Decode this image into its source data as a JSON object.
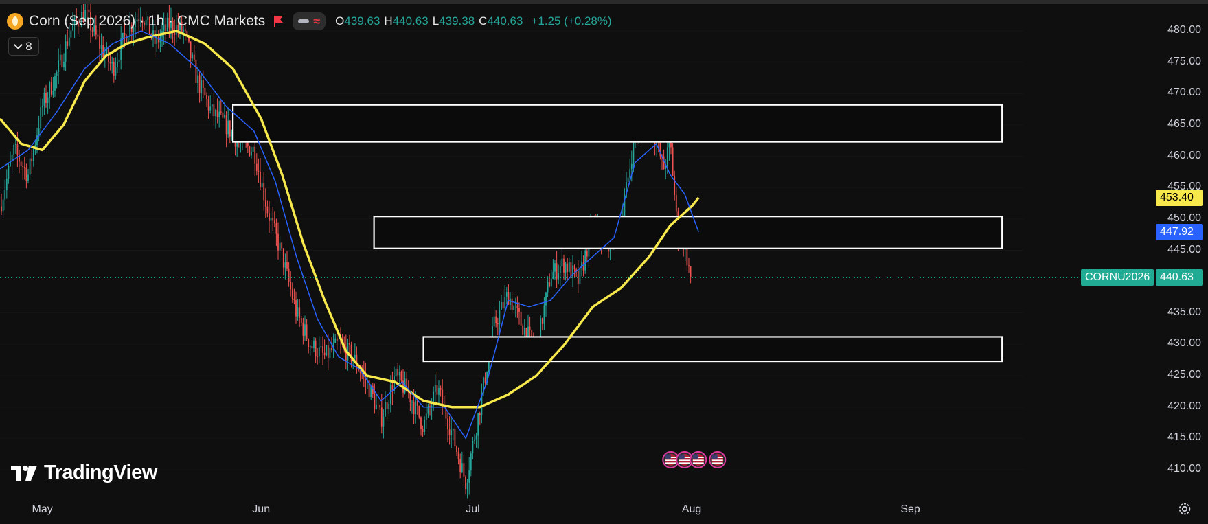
{
  "header": {
    "symbol_title": "Corn (Sep 2026) · 1h · CMC Markets",
    "ohlc": {
      "o_label": "O",
      "o": "439.63",
      "h_label": "H",
      "h": "440.63",
      "l_label": "L",
      "l": "439.38",
      "c_label": "C",
      "c": "440.63",
      "change": "+1.25 (+0.28%)"
    },
    "indicator_count": "8"
  },
  "colors": {
    "background": "#0f0f0f",
    "up": "#26a69a",
    "down": "#ef5350",
    "ma_slow": "#f7e84b",
    "ma_fast": "#2962ff",
    "zone_stroke": "#ffffff"
  },
  "chart_data": {
    "type": "candlestick",
    "symbol": "CORNU2026",
    "interval": "1h",
    "y_axis": {
      "ticks": [
        "480.00",
        "475.00",
        "470.00",
        "465.00",
        "460.00",
        "455.00",
        "450.00",
        "445.00",
        "435.00",
        "430.00",
        "425.00",
        "420.00",
        "415.00",
        "410.00"
      ],
      "ylim": [
        406,
        482
      ]
    },
    "x_axis": {
      "ticks": [
        "May",
        "Jun",
        "Jul",
        "Aug",
        "Sep"
      ],
      "range": [
        "2026-04-25",
        "2026-09-17"
      ]
    },
    "price_path": [
      [
        "2026-04-25",
        452
      ],
      [
        "2026-04-27",
        461
      ],
      [
        "2026-04-29",
        457
      ],
      [
        "2026-05-01",
        468
      ],
      [
        "2026-05-03",
        473
      ],
      [
        "2026-05-05",
        480
      ],
      [
        "2026-05-07",
        483
      ],
      [
        "2026-05-09",
        478
      ],
      [
        "2026-05-11",
        474
      ],
      [
        "2026-05-13",
        480
      ],
      [
        "2026-05-15",
        483
      ],
      [
        "2026-05-17",
        478
      ],
      [
        "2026-05-19",
        481
      ],
      [
        "2026-05-21",
        480
      ],
      [
        "2026-05-23",
        472
      ],
      [
        "2026-05-25",
        467
      ],
      [
        "2026-05-27",
        465
      ],
      [
        "2026-05-29",
        462
      ],
      [
        "2026-05-31",
        461
      ],
      [
        "2026-06-02",
        451
      ],
      [
        "2026-06-04",
        444
      ],
      [
        "2026-06-06",
        435
      ],
      [
        "2026-06-08",
        430
      ],
      [
        "2026-06-10",
        428
      ],
      [
        "2026-06-12",
        430
      ],
      [
        "2026-06-14",
        428
      ],
      [
        "2026-06-16",
        424
      ],
      [
        "2026-06-18",
        418
      ],
      [
        "2026-06-20",
        425
      ],
      [
        "2026-06-22",
        422
      ],
      [
        "2026-06-24",
        417
      ],
      [
        "2026-06-26",
        423
      ],
      [
        "2026-06-28",
        416
      ],
      [
        "2026-06-30",
        408
      ],
      [
        "2026-07-02",
        420
      ],
      [
        "2026-07-04",
        433
      ],
      [
        "2026-07-06",
        438
      ],
      [
        "2026-07-08",
        433
      ],
      [
        "2026-07-10",
        429
      ],
      [
        "2026-07-12",
        441
      ],
      [
        "2026-07-14",
        443
      ],
      [
        "2026-07-16",
        440
      ],
      [
        "2026-07-18",
        449
      ],
      [
        "2026-07-20",
        446
      ],
      [
        "2026-07-22",
        449
      ],
      [
        "2026-07-24",
        464
      ],
      [
        "2026-07-26",
        467
      ],
      [
        "2026-07-28",
        458
      ],
      [
        "2026-07-29",
        462
      ],
      [
        "2026-07-30",
        448
      ],
      [
        "2026-07-31",
        446
      ],
      [
        "2026-08-01",
        439.6
      ],
      [
        "2026-08-01",
        440.63
      ]
    ],
    "series": [
      {
        "name": "",
        "role": "slow moving average",
        "color": "#f7e84b",
        "points": [
          [
            "2026-04-25",
            466
          ],
          [
            "2026-04-28",
            462
          ],
          [
            "2026-05-01",
            461
          ],
          [
            "2026-05-04",
            465
          ],
          [
            "2026-05-07",
            472
          ],
          [
            "2026-05-10",
            476
          ],
          [
            "2026-05-13",
            478
          ],
          [
            "2026-05-16",
            479
          ],
          [
            "2026-05-20",
            480
          ],
          [
            "2026-05-24",
            478
          ],
          [
            "2026-05-28",
            474
          ],
          [
            "2026-06-01",
            466
          ],
          [
            "2026-06-04",
            457
          ],
          [
            "2026-06-07",
            446
          ],
          [
            "2026-06-10",
            437
          ],
          [
            "2026-06-13",
            429
          ],
          [
            "2026-06-16",
            425
          ],
          [
            "2026-06-20",
            424
          ],
          [
            "2026-06-24",
            421
          ],
          [
            "2026-06-28",
            420
          ],
          [
            "2026-07-02",
            420
          ],
          [
            "2026-07-06",
            422
          ],
          [
            "2026-07-10",
            425
          ],
          [
            "2026-07-14",
            430
          ],
          [
            "2026-07-18",
            436
          ],
          [
            "2026-07-22",
            439
          ],
          [
            "2026-07-26",
            444
          ],
          [
            "2026-07-29",
            449
          ],
          [
            "2026-08-01",
            452
          ],
          [
            "2026-08-02",
            453.4
          ]
        ]
      },
      {
        "name": "",
        "role": "fast moving average",
        "color": "#2962ff",
        "points": [
          [
            "2026-04-25",
            458
          ],
          [
            "2026-04-29",
            461
          ],
          [
            "2026-05-03",
            467
          ],
          [
            "2026-05-07",
            474
          ],
          [
            "2026-05-11",
            478
          ],
          [
            "2026-05-15",
            480
          ],
          [
            "2026-05-19",
            478
          ],
          [
            "2026-05-23",
            474
          ],
          [
            "2026-05-27",
            468
          ],
          [
            "2026-05-31",
            464
          ],
          [
            "2026-06-03",
            456
          ],
          [
            "2026-06-06",
            444
          ],
          [
            "2026-06-09",
            434
          ],
          [
            "2026-06-12",
            428
          ],
          [
            "2026-06-15",
            426
          ],
          [
            "2026-06-18",
            421
          ],
          [
            "2026-06-21",
            424
          ],
          [
            "2026-06-24",
            420
          ],
          [
            "2026-06-27",
            420
          ],
          [
            "2026-06-30",
            415
          ],
          [
            "2026-07-03",
            424
          ],
          [
            "2026-07-06",
            437
          ],
          [
            "2026-07-09",
            436
          ],
          [
            "2026-07-12",
            437
          ],
          [
            "2026-07-15",
            441
          ],
          [
            "2026-07-18",
            444
          ],
          [
            "2026-07-21",
            447
          ],
          [
            "2026-07-24",
            459
          ],
          [
            "2026-07-27",
            462
          ],
          [
            "2026-07-29",
            457
          ],
          [
            "2026-07-31",
            454
          ],
          [
            "2026-08-02",
            447.92
          ]
        ]
      }
    ],
    "zones": [
      {
        "from": "2026-05-28",
        "to": "2026-09-14",
        "low": 462.3,
        "high": 468.2
      },
      {
        "from": "2026-06-17",
        "to": "2026-09-14",
        "low": 445.3,
        "high": 450.4
      },
      {
        "from": "2026-06-24",
        "to": "2026-09-14",
        "low": 427.3,
        "high": 431.2
      }
    ],
    "price_labels": [
      {
        "value": "453.40",
        "series": "slow moving average",
        "bg": "#f7e84b",
        "fg": "#000000",
        "y": 453.4
      },
      {
        "value": "447.92",
        "series": "fast moving average",
        "bg": "#2962ff",
        "fg": "#ffffff",
        "y": 447.92
      },
      {
        "value": "440.63",
        "symbol": "CORNU2026",
        "bg": "#22ab94",
        "fg": "#ffffff",
        "y": 440.63
      }
    ],
    "last_price": 440.63,
    "events": {
      "date": "2026-07-31",
      "count": 4,
      "icon": "us-flag-icon"
    }
  },
  "watermark": {
    "text": "TradingView"
  }
}
